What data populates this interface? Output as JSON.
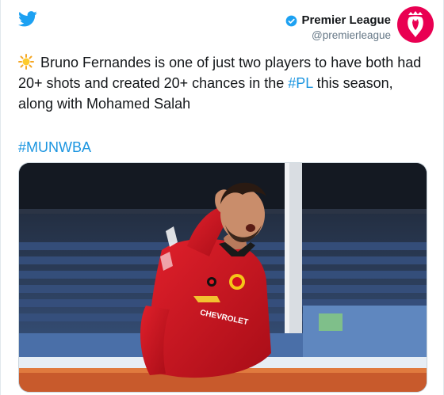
{
  "tweet": {
    "display_name": "Premier League",
    "handle": "@premierleague",
    "text_parts": {
      "before": "Bruno Fernandes is one of just two players to have both had 20+ shots and created 20+ chances in the ",
      "hashtag": "#PL",
      "after": " this season, along with Mohamed Salah"
    },
    "hashtag_line": "#MUNWBA",
    "media_label": "CHEVROLET"
  },
  "icons": {
    "brand": "twitter-bird-icon",
    "verified": "verified-badge-icon",
    "emoji": "sun-emoji-icon",
    "avatar": "premier-league-lion-logo"
  },
  "colors": {
    "twitter_blue": "#1da1f2",
    "hashtag_blue": "#1b95e0",
    "avatar_bg": "#e90052",
    "shirt_red": "#d4111e"
  }
}
